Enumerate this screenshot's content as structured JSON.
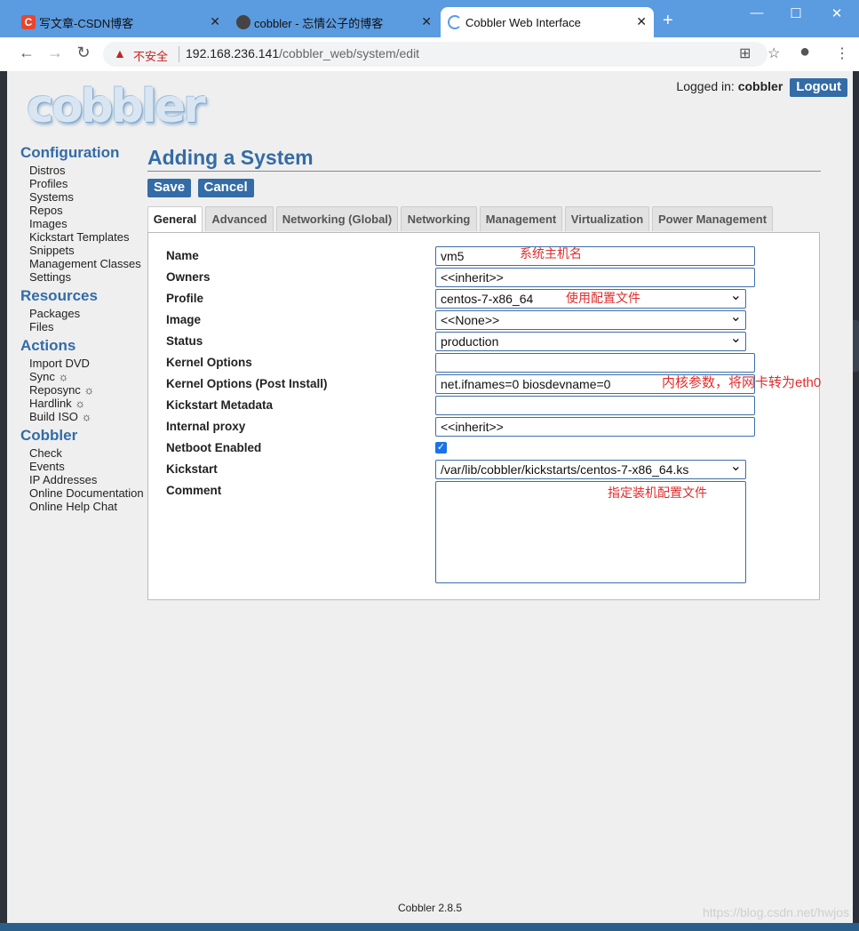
{
  "browser": {
    "tabs": [
      {
        "title": "写文章-CSDN博客"
      },
      {
        "title": "cobbler - 忘情公子的博客"
      },
      {
        "title": "Cobbler Web Interface"
      }
    ],
    "insecure_label": "不安全",
    "url_host": "192.168.236.141",
    "url_path": "/cobbler_web/system/edit"
  },
  "header": {
    "logo_text": "cobbler",
    "logged_in_label": "Logged in:",
    "username": "cobbler",
    "logout_label": "Logout"
  },
  "sidebar": {
    "configuration": {
      "title": "Configuration",
      "items": [
        "Distros",
        "Profiles",
        "Systems",
        "Repos",
        "Images",
        "Kickstart Templates",
        "Snippets",
        "Management Classes",
        "Settings"
      ]
    },
    "resources": {
      "title": "Resources",
      "items": [
        "Packages",
        "Files"
      ]
    },
    "actions": {
      "title": "Actions",
      "items": [
        "Import DVD",
        "Sync ☼",
        "Reposync ☼",
        "Hardlink ☼",
        "Build ISO ☼"
      ]
    },
    "cobbler": {
      "title": "Cobbler",
      "items": [
        "Check",
        "Events",
        "IP Addresses",
        "Online Documentation",
        "Online Help Chat"
      ]
    }
  },
  "main": {
    "title": "Adding a System",
    "save_label": "Save",
    "cancel_label": "Cancel",
    "tabs": [
      "General",
      "Advanced",
      "Networking (Global)",
      "Networking",
      "Management",
      "Virtualization",
      "Power Management"
    ],
    "form": {
      "name": {
        "label": "Name",
        "value": "vm5"
      },
      "owners": {
        "label": "Owners",
        "value": "<<inherit>>"
      },
      "profile": {
        "label": "Profile",
        "value": "centos-7-x86_64"
      },
      "image": {
        "label": "Image",
        "value": "<<None>>"
      },
      "status": {
        "label": "Status",
        "value": "production"
      },
      "kernel_options": {
        "label": "Kernel Options",
        "value": ""
      },
      "kernel_options_post": {
        "label": "Kernel Options (Post Install)",
        "value": "net.ifnames=0 biosdevname=0"
      },
      "kickstart_metadata": {
        "label": "Kickstart Metadata",
        "value": ""
      },
      "internal_proxy": {
        "label": "Internal proxy",
        "value": "<<inherit>>"
      },
      "netboot_enabled": {
        "label": "Netboot Enabled",
        "checked": true
      },
      "kickstart": {
        "label": "Kickstart",
        "value": "/var/lib/cobbler/kickstarts/centos-7-x86_64.ks"
      },
      "comment": {
        "label": "Comment",
        "value": ""
      }
    },
    "annotations": {
      "hostname": "系统主机名",
      "profile": "使用配置文件",
      "kernel": "内核参数，将网卡转为eth0",
      "kickstart": "指定装机配置文件"
    }
  },
  "footer": {
    "version": "Cobbler 2.8.5"
  },
  "watermark": "https://blog.csdn.net/hwjos"
}
